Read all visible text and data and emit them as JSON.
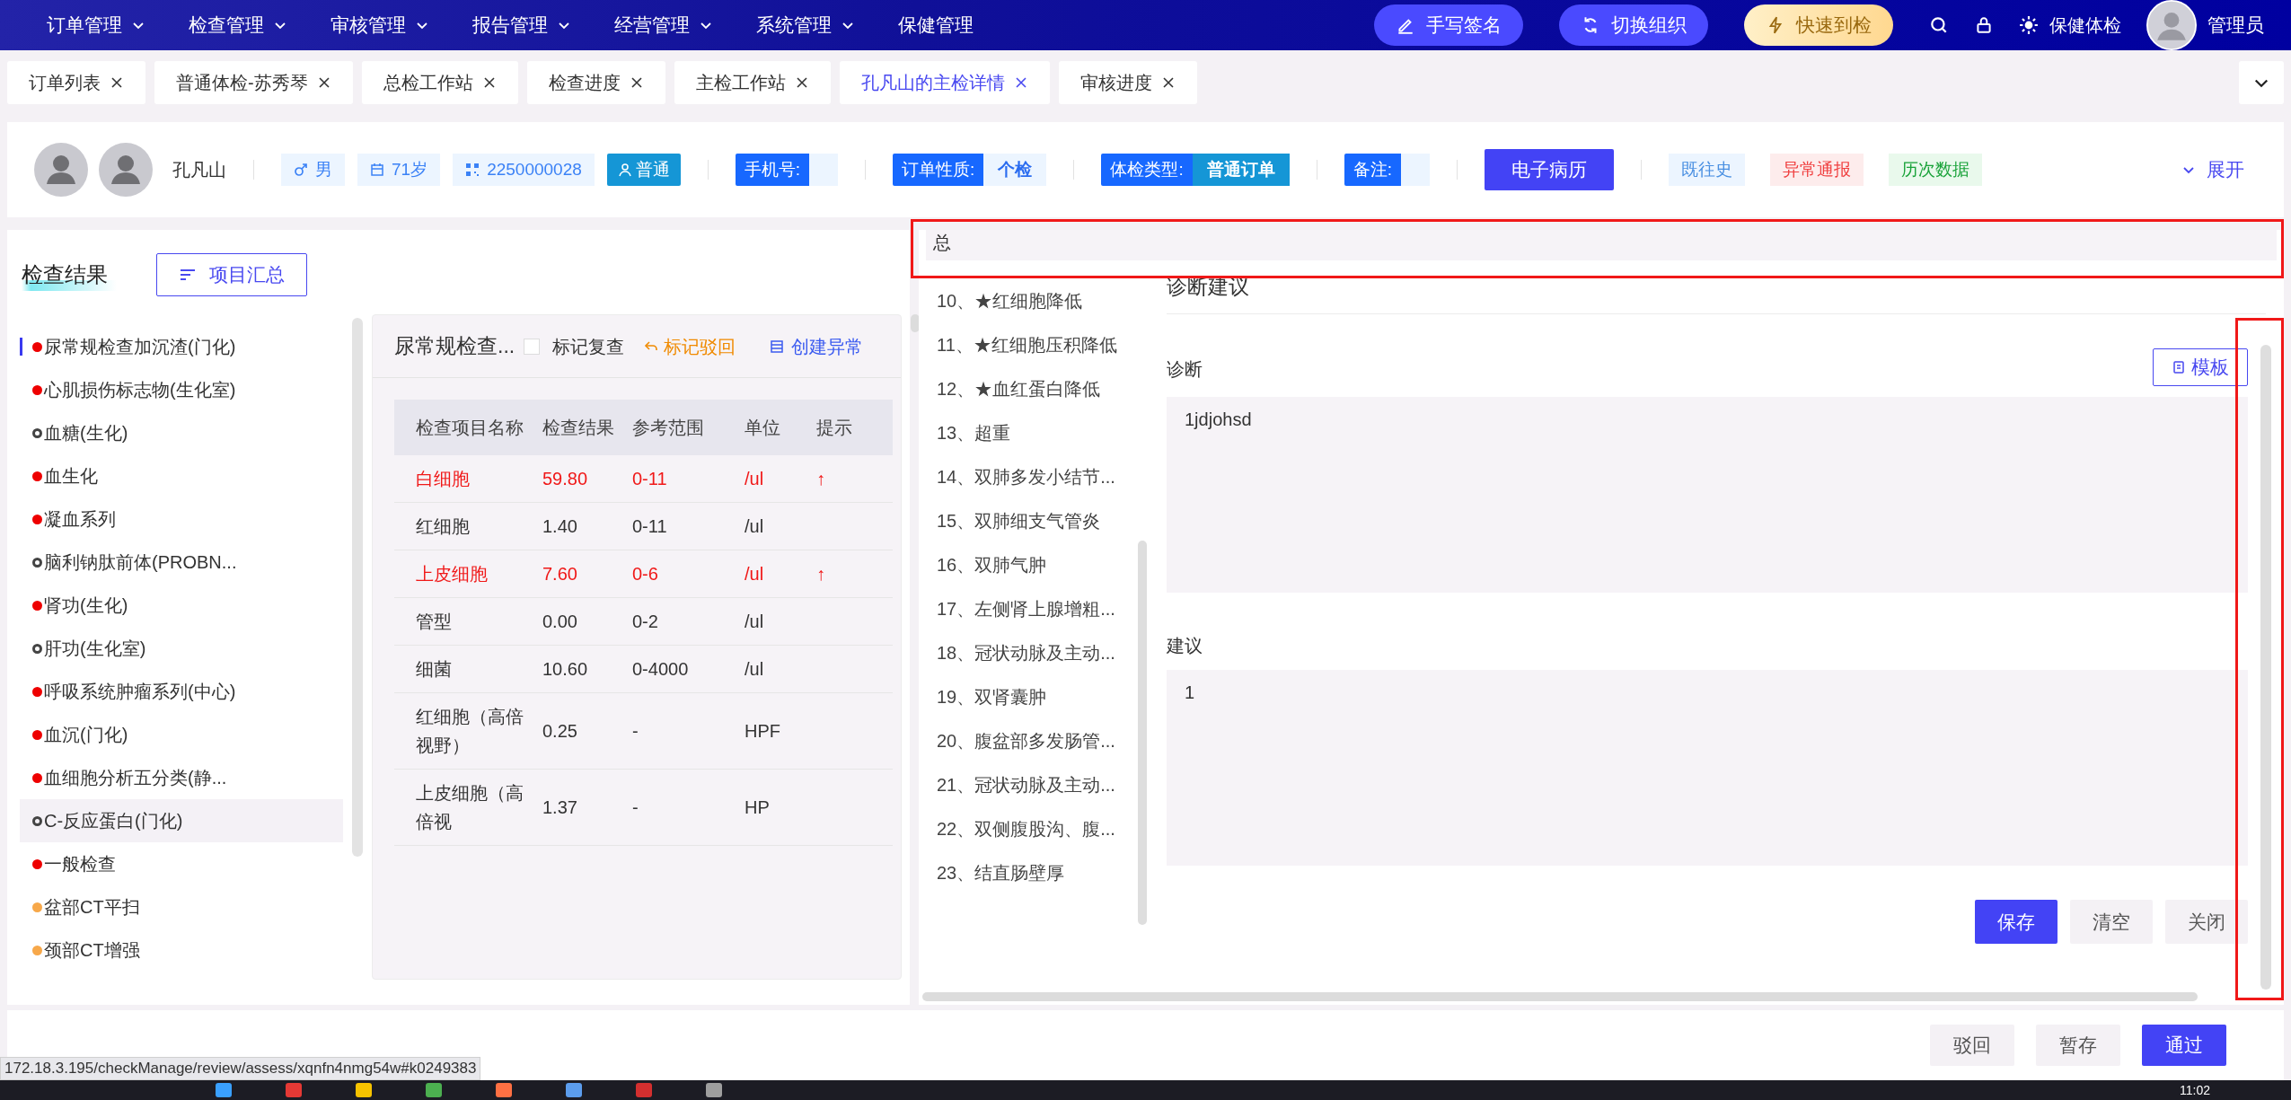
{
  "nav": {
    "menus": [
      {
        "label": "订单管理",
        "dropdown": true
      },
      {
        "label": "检查管理",
        "dropdown": true
      },
      {
        "label": "审核管理",
        "dropdown": true
      },
      {
        "label": "报告管理",
        "dropdown": true
      },
      {
        "label": "经营管理",
        "dropdown": true
      },
      {
        "label": "系统管理",
        "dropdown": true
      },
      {
        "label": "保健管理",
        "dropdown": false
      }
    ],
    "actions": [
      {
        "label": "手写签名",
        "kind": "sign"
      },
      {
        "label": "切换组织",
        "kind": "switch"
      },
      {
        "label": "快速到检",
        "kind": "quick"
      }
    ],
    "org": "保健体检",
    "user": "管理员"
  },
  "tabs": [
    {
      "label": "订单列表",
      "selected": false
    },
    {
      "label": "普通体检-苏秀琴",
      "selected": false
    },
    {
      "label": "总检工作站",
      "selected": false
    },
    {
      "label": "检查进度",
      "selected": false
    },
    {
      "label": "主检工作站",
      "selected": false
    },
    {
      "label": "孔凡山的主检详情",
      "selected": true
    },
    {
      "label": "审核进度",
      "selected": false
    }
  ],
  "patient": {
    "name": "孔凡山",
    "gender": "男",
    "age": "71岁",
    "code": "2250000028",
    "grade": "普通",
    "fields": [
      {
        "label": "手机号:"
      },
      {
        "label": "订单性质:",
        "value": "个检",
        "kind": "light"
      },
      {
        "label": "体检类型:",
        "value": "普通订单",
        "kind": "filled"
      },
      {
        "label": "备注:"
      }
    ],
    "record_button": "电子病历",
    "links": [
      {
        "label": "既往史",
        "kind": "info"
      },
      {
        "label": "异常通报",
        "kind": "danger"
      },
      {
        "label": "历次数据",
        "kind": "success"
      }
    ],
    "expand": "展开"
  },
  "results": {
    "title": "检查结果",
    "summary_button": "项目汇总",
    "items": [
      {
        "label": "尿常规检查加沉渣(门化)",
        "color": "#ee0000",
        "filled": true,
        "selected": true,
        "hovered": false
      },
      {
        "label": "心肌损伤标志物(生化室)",
        "color": "#ee0000",
        "filled": true,
        "selected": false,
        "hovered": false
      },
      {
        "label": "血糖(生化)",
        "color": "#444444",
        "filled": false,
        "selected": false,
        "hovered": false
      },
      {
        "label": "血生化",
        "color": "#ee0000",
        "filled": true,
        "selected": false,
        "hovered": false
      },
      {
        "label": "凝血系列",
        "color": "#ee0000",
        "filled": true,
        "selected": false,
        "hovered": false
      },
      {
        "label": "脑利钠肽前体(PROBN...",
        "color": "#444444",
        "filled": false,
        "selected": false,
        "hovered": false
      },
      {
        "label": "肾功(生化)",
        "color": "#ee0000",
        "filled": true,
        "selected": false,
        "hovered": false
      },
      {
        "label": "肝功(生化室)",
        "color": "#444444",
        "filled": false,
        "selected": false,
        "hovered": false
      },
      {
        "label": "呼吸系统肿瘤系列(中心)",
        "color": "#ee0000",
        "filled": true,
        "selected": false,
        "hovered": false
      },
      {
        "label": "血沉(门化)",
        "color": "#ee0000",
        "filled": true,
        "selected": false,
        "hovered": false
      },
      {
        "label": "血细胞分析五分类(静...",
        "color": "#ee0000",
        "filled": true,
        "selected": false,
        "hovered": false
      },
      {
        "label": "C-反应蛋白(门化)",
        "color": "#444444",
        "filled": false,
        "selected": false,
        "hovered": true
      },
      {
        "label": "一般检查",
        "color": "#ee0000",
        "filled": true,
        "selected": false,
        "hovered": false
      },
      {
        "label": "盆部CT平扫",
        "color": "#f7a84a",
        "filled": true,
        "selected": false,
        "hovered": false
      },
      {
        "label": "颈部CT增强",
        "color": "#f7a84a",
        "filled": true,
        "selected": false,
        "hovered": false
      }
    ]
  },
  "card": {
    "title": "尿常规检查...",
    "recheck": {
      "label": "标记复查",
      "checked": false
    },
    "reject": "标记驳回",
    "create": "创建异常",
    "columns": [
      "检查项目名称",
      "检查结果",
      "参考范围",
      "单位",
      "提示"
    ],
    "rows": [
      {
        "name": "白细胞",
        "result": "59.80",
        "range": "0-11",
        "unit": "/ul",
        "hint": "↑",
        "abnormal": true
      },
      {
        "name": "红细胞",
        "result": "1.40",
        "range": "0-11",
        "unit": "/ul",
        "abnormal": false
      },
      {
        "name": "上皮细胞",
        "result": "7.60",
        "range": "0-6",
        "unit": "/ul",
        "hint": "↑",
        "abnormal": true
      },
      {
        "name": "管型",
        "result": "0.00",
        "range": "0-2",
        "unit": "/ul",
        "abnormal": false
      },
      {
        "name": "细菌",
        "result": "10.60",
        "range": "0-4000",
        "unit": "/ul",
        "abnormal": false
      },
      {
        "name": "红细胞（高倍视野）",
        "result": "0.25",
        "range": "-",
        "unit": "HPF",
        "abnormal": false
      },
      {
        "name": "上皮细胞（高倍视",
        "result": "1.37",
        "range": "-",
        "unit": "HP",
        "abnormal": false
      }
    ]
  },
  "summary": {
    "header": "总",
    "conclusions": [
      "10、★红细胞降低",
      "11、★红细胞压积降低",
      "12、★血红蛋白降低",
      "13、超重",
      "14、双肺多发小结节...",
      "15、双肺细支气管炎",
      "16、双肺气肿",
      "17、左侧肾上腺增粗...",
      "18、冠状动脉及主动...",
      "19、双肾囊肿",
      "20、腹盆部多发肠管...",
      "21、冠状动脉及主动...",
      "22、双侧腹股沟、腹...",
      "23、结直肠壁厚"
    ],
    "section_title": "诊断建议",
    "template_button": "模板",
    "diagnosis": {
      "label": "诊断",
      "value": "1jdjohsd"
    },
    "advice": {
      "label": "建议",
      "value": "1"
    },
    "buttons": [
      {
        "label": "保存",
        "kind": "primary"
      },
      {
        "label": "清空",
        "kind": "plain"
      },
      {
        "label": "关闭",
        "kind": "plain"
      }
    ]
  },
  "footer_buttons": [
    {
      "label": "驳回",
      "kind": "plain"
    },
    {
      "label": "暂存",
      "kind": "plain"
    },
    {
      "label": "通过",
      "kind": "primary"
    }
  ],
  "status_url": "172.18.3.195/checkManage/review/assess/xqnfn4nmg54w#k0249383",
  "taskbar": {
    "time": "11:02"
  }
}
